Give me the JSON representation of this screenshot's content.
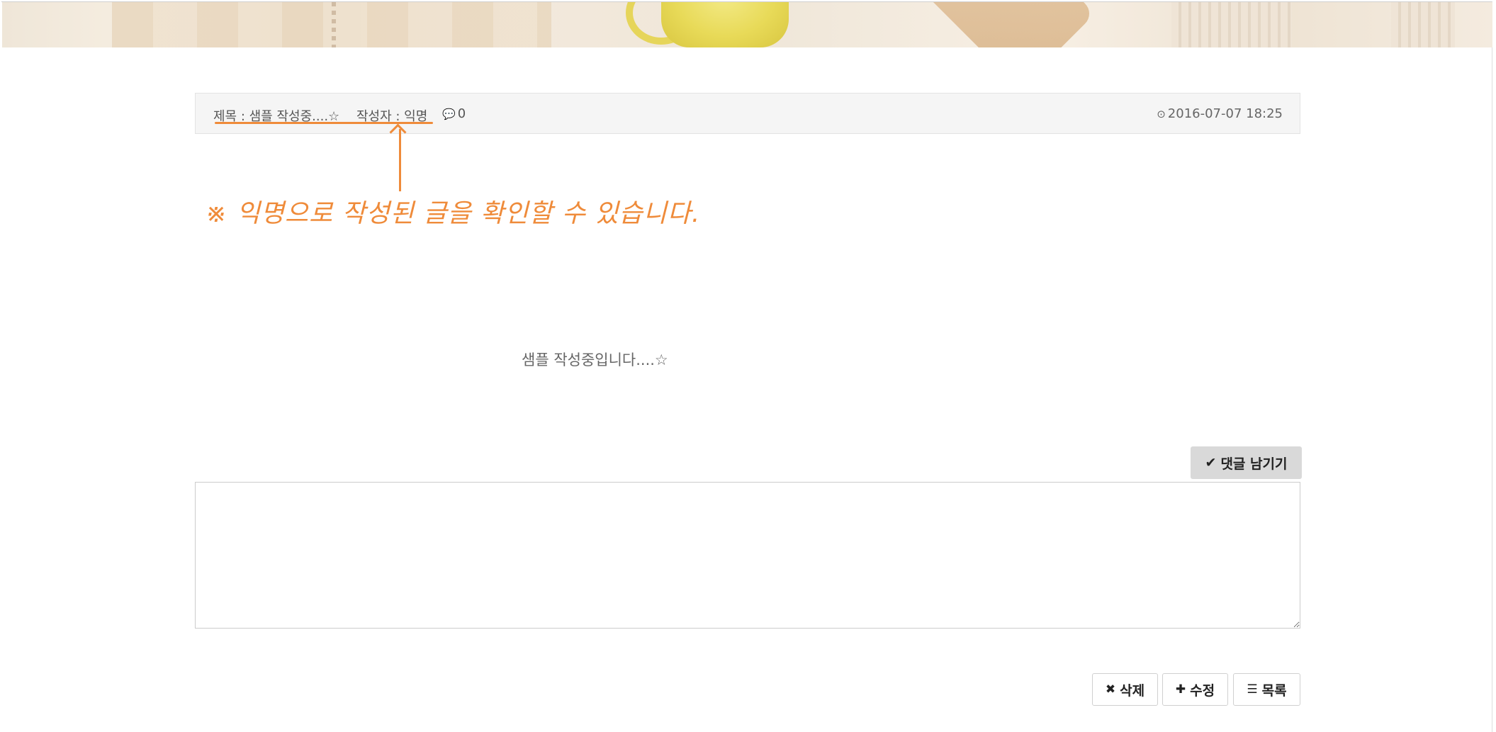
{
  "post": {
    "title": "제목 : 샘플 작성중....☆",
    "author": "작성자 : 익명",
    "comment_count": "0",
    "date": "2016-07-07 18:25",
    "content": "샘플 작성중입니다....☆"
  },
  "annotation": {
    "note": "※ 익명으로 작성된 글을 확인할 수 있습니다."
  },
  "comment": {
    "button_label": "댓글 남기기",
    "textarea_value": ""
  },
  "actions": {
    "delete_label": "삭제",
    "edit_label": "수정",
    "list_label": "목록"
  },
  "icons": {
    "comment": "comment-icon",
    "clock": "clock-icon",
    "check": "check-icon",
    "close": "close-icon",
    "plus": "plus-icon",
    "list": "list-icon"
  },
  "colors": {
    "annotation": "#ef8b3a",
    "header_bg": "#f5f5f5",
    "comment_button_bg": "#d9d9d9"
  }
}
